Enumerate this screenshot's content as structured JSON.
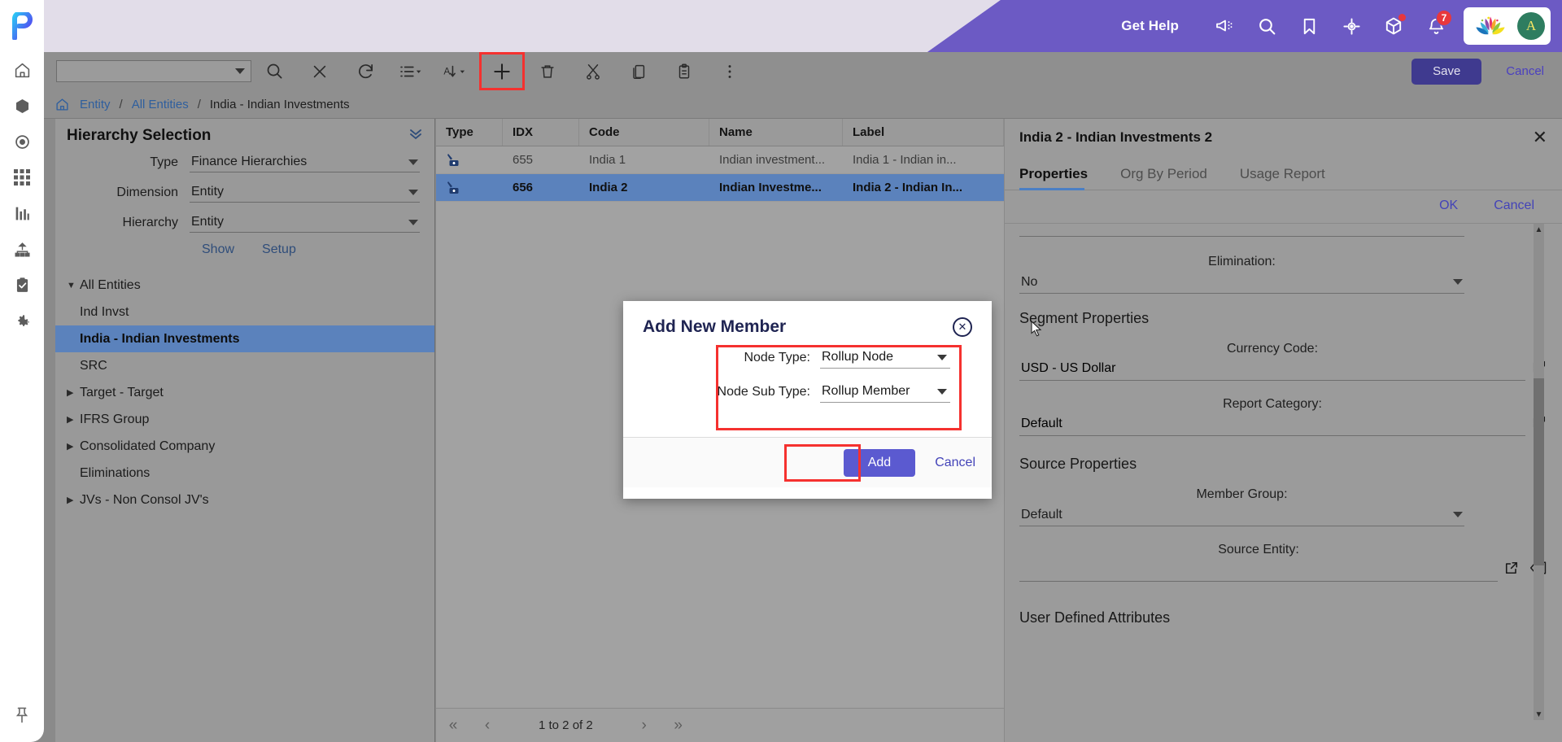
{
  "header": {
    "get_help": "Get Help",
    "icons": [
      "megaphone-icon",
      "search-icon",
      "bookmark-icon",
      "target-icon",
      "cube-icon",
      "bell-icon"
    ],
    "notification_count": "7",
    "avatar_initial": "A",
    "brand_color": "#6c5ac4"
  },
  "rail": {
    "logo": "p-logo",
    "items": [
      {
        "icon": "home-icon",
        "name": "sidebar-item-home"
      },
      {
        "icon": "cube-icon",
        "name": "sidebar-item-models"
      },
      {
        "icon": "target-icon",
        "name": "sidebar-item-target"
      },
      {
        "icon": "grid-icon",
        "name": "sidebar-item-grid"
      },
      {
        "icon": "bar-chart-icon",
        "name": "sidebar-item-reports"
      },
      {
        "icon": "hierarchy-icon",
        "name": "sidebar-item-hierarchy"
      },
      {
        "icon": "clipboard-check-icon",
        "name": "sidebar-item-tasks"
      },
      {
        "icon": "gear-icon",
        "name": "sidebar-item-settings"
      }
    ],
    "pin": "pushpin-icon"
  },
  "toolbar": {
    "dropdown_value": "",
    "icons": [
      {
        "name": "search-icon",
        "label": "Search"
      },
      {
        "name": "clear-icon",
        "label": "Clear"
      },
      {
        "name": "refresh-icon",
        "label": "Refresh"
      },
      {
        "name": "list-view-icon",
        "label": "View"
      },
      {
        "name": "sort-icon",
        "label": "Sort"
      },
      {
        "name": "add-icon",
        "label": "Add",
        "highlighted": true
      },
      {
        "name": "delete-icon",
        "label": "Delete"
      },
      {
        "name": "cut-icon",
        "label": "Cut"
      },
      {
        "name": "copy-icon",
        "label": "Copy"
      },
      {
        "name": "paste-icon",
        "label": "Paste"
      },
      {
        "name": "more-icon",
        "label": "More"
      }
    ],
    "save_label": "Save",
    "cancel_label": "Cancel"
  },
  "breadcrumb": {
    "home_icon": "home-icon",
    "items": [
      "Entity",
      "All Entities"
    ],
    "current": "India - Indian Investments",
    "separator": "/"
  },
  "hierarchy": {
    "title": "Hierarchy Selection",
    "collapse_icon": "chevron-double-down-icon",
    "fields": [
      {
        "label": "Type",
        "value": "Finance Hierarchies"
      },
      {
        "label": "Dimension",
        "value": "Entity"
      },
      {
        "label": "Hierarchy",
        "value": "Entity"
      }
    ],
    "show_label": "Show",
    "setup_label": "Setup",
    "tree": [
      {
        "label": "All Entities",
        "indent": 0,
        "arrow": "down",
        "selected": false
      },
      {
        "label": "Ind Invst",
        "indent": 1,
        "arrow": "none",
        "selected": false
      },
      {
        "label": "India - Indian Investments",
        "indent": 1,
        "arrow": "none",
        "selected": true
      },
      {
        "label": "SRC",
        "indent": 1,
        "arrow": "none",
        "selected": false
      },
      {
        "label": "Target - Target",
        "indent": 1,
        "arrow": "right",
        "selected": false
      },
      {
        "label": "IFRS Group",
        "indent": 1,
        "arrow": "right",
        "selected": false
      },
      {
        "label": "Consolidated Company",
        "indent": 1,
        "arrow": "right",
        "selected": false
      },
      {
        "label": "Eliminations",
        "indent": 1,
        "arrow": "none",
        "selected": false
      },
      {
        "label": "JVs - Non Consol JV's",
        "indent": 1,
        "arrow": "right",
        "selected": false
      }
    ]
  },
  "grid": {
    "columns": [
      "Type",
      "IDX",
      "Code",
      "Name",
      "Label"
    ],
    "rows": [
      {
        "type_icon": "rollup-node-icon",
        "idx": "655",
        "code": "India 1",
        "name": "Indian investment...",
        "label": "India 1 - Indian in...",
        "selected": false
      },
      {
        "type_icon": "rollup-node-icon",
        "idx": "656",
        "code": "India 2",
        "name": "Indian Investme...",
        "label": "India 2 - Indian In...",
        "selected": true
      }
    ],
    "pager": {
      "first_icon": "double-chevron-left-icon",
      "prev_icon": "chevron-left-icon",
      "text": "1 to 2 of 2",
      "next_icon": "chevron-right-icon",
      "last_icon": "double-chevron-right-icon"
    }
  },
  "properties": {
    "title": "India 2 - Indian Investments 2",
    "close_icon": "close-icon",
    "tabs": [
      {
        "label": "Properties",
        "active": true
      },
      {
        "label": "Org By Period",
        "active": false
      },
      {
        "label": "Usage Report",
        "active": false
      }
    ],
    "ok_label": "OK",
    "cancel_label": "Cancel",
    "fields": [
      {
        "label": "Elimination:",
        "value": "No",
        "kind": "select"
      }
    ],
    "segment_section": "Segment Properties",
    "segment_fields": [
      {
        "label": "Currency Code:",
        "value": "USD - US Dollar",
        "kind": "lookup",
        "dim": true
      },
      {
        "label": "Report Category:",
        "value": "Default",
        "kind": "lookup",
        "dim": true
      }
    ],
    "source_section": "Source Properties",
    "source_fields": [
      {
        "label": "Member Group:",
        "value": "Default",
        "kind": "select"
      },
      {
        "label": "Source Entity:",
        "value": "",
        "kind": "lookup-clear"
      }
    ],
    "uda_section": "User Defined Attributes"
  },
  "dialog": {
    "title": "Add New Member",
    "close_icon": "close-circle-icon",
    "fields": [
      {
        "label": "Node Type:",
        "value": "Rollup Node"
      },
      {
        "label": "Node Sub Type:",
        "value": "Rollup Member"
      }
    ],
    "add_label": "Add",
    "cancel_label": "Cancel",
    "highlight_color": "#f5312f",
    "add_button_color": "#5b5ad0"
  }
}
